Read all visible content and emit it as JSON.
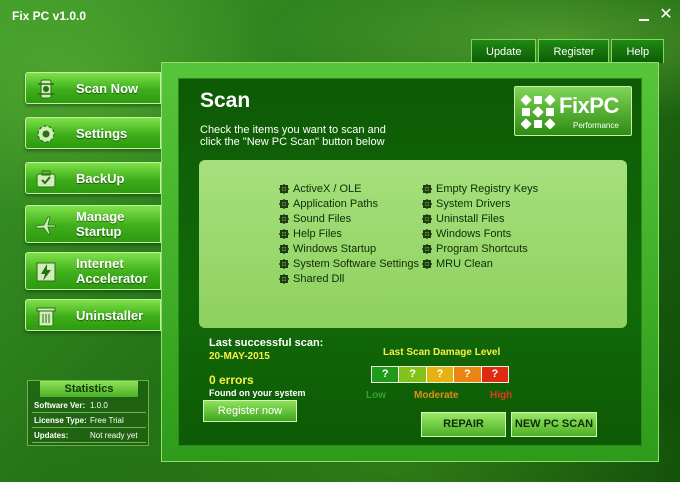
{
  "window": {
    "title": "Fix PC v1.0.0"
  },
  "topnav": [
    "Update",
    "Register",
    "Help"
  ],
  "sidebar": {
    "items": [
      {
        "label": "Scan Now",
        "icon": "gear-cog-icon"
      },
      {
        "label": "Settings",
        "icon": "gear-icon"
      },
      {
        "label": "BackUp",
        "icon": "briefcase-icon"
      },
      {
        "label": "Manage\nStartup",
        "icon": "airplane-icon"
      },
      {
        "label": "Internet\nAccelerator",
        "icon": "lightning-icon"
      },
      {
        "label": "Uninstaller",
        "icon": "trash-icon"
      }
    ]
  },
  "stats": {
    "title": "Statistics",
    "rows": [
      {
        "key": "Software Ver:",
        "value": "1.0.0"
      },
      {
        "key": "License Type:",
        "value": "Free Trial"
      },
      {
        "key": "Updates:",
        "value": "Not ready yet"
      }
    ]
  },
  "main": {
    "title": "Scan",
    "description": "Check the items you want to scan and click the \"New PC Scan\" button below",
    "logo": {
      "brand": "FixPC",
      "tagline": "Performance"
    },
    "scan_items_left": [
      "ActiveX / OLE",
      "Application Paths",
      "Sound Files",
      "Help Files",
      "Windows Startup",
      "System Software Settings",
      "Shared Dll"
    ],
    "scan_items_right": [
      "Empty Registry Keys",
      "System Drivers",
      "Uninstall Files",
      "Windows Fonts",
      "Program Shortcuts",
      "MRU Clean"
    ],
    "last_scan_label": "Last successful scan:",
    "last_scan_date": "20-MAY-2015",
    "errors": "0 errors",
    "found_text": "Found on your system",
    "register_button": "Register now",
    "damage": {
      "title": "Last Scan Damage Level",
      "cells": [
        "?",
        "?",
        "?",
        "?",
        "?"
      ],
      "cell_colors": [
        "#1f9a1a",
        "#84c21b",
        "#e5b212",
        "#ea8412",
        "#e02b12"
      ],
      "low": "Low",
      "moderate": "Moderate",
      "high": "High"
    },
    "repair_button": "REPAIR",
    "new_scan_button": "NEW PC SCAN"
  }
}
